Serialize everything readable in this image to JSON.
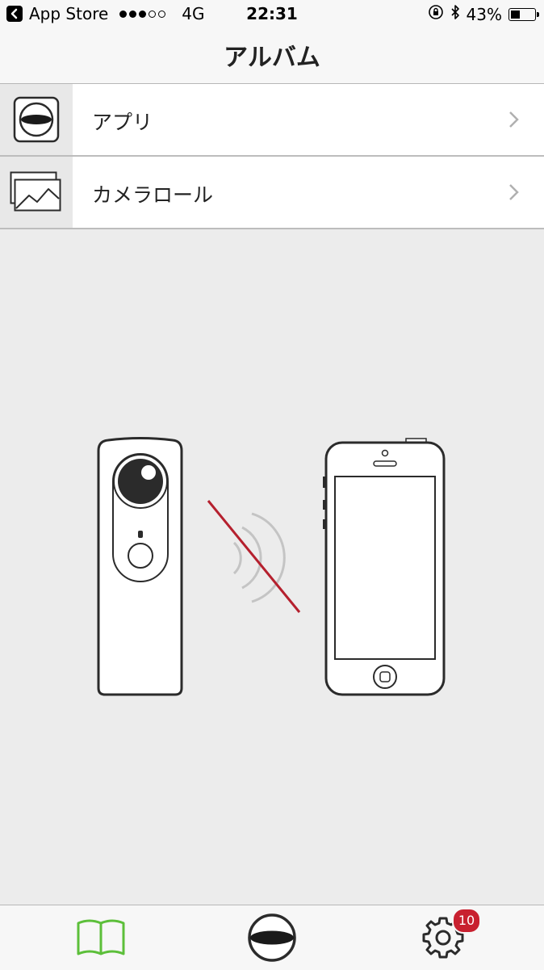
{
  "status_bar": {
    "back_app": "App Store",
    "signal_dots_filled": 3,
    "signal_dots_total": 5,
    "network": "4G",
    "time": "22:31",
    "battery_percent": "43%",
    "battery_level": 0.43
  },
  "nav": {
    "title": "アルバム"
  },
  "list": {
    "items": [
      {
        "label": "アプリ",
        "icon": "theta-app-icon"
      },
      {
        "label": "カメラロール",
        "icon": "photos-icon"
      }
    ]
  },
  "illustration": {
    "description_icons": [
      "camera-illustration",
      "wifi-waves",
      "disconnected-slash",
      "smartphone-illustration"
    ],
    "slash_color": "#b5202e"
  },
  "tab_bar": {
    "tabs": [
      {
        "name": "guide",
        "icon": "book-icon",
        "active": true,
        "color": "#5cbf3a"
      },
      {
        "name": "camera",
        "icon": "theta-shutter-icon",
        "active": false
      },
      {
        "name": "settings",
        "icon": "gear-icon",
        "active": false
      }
    ],
    "settings_badge": "10",
    "badge_color": "#c8202f"
  }
}
